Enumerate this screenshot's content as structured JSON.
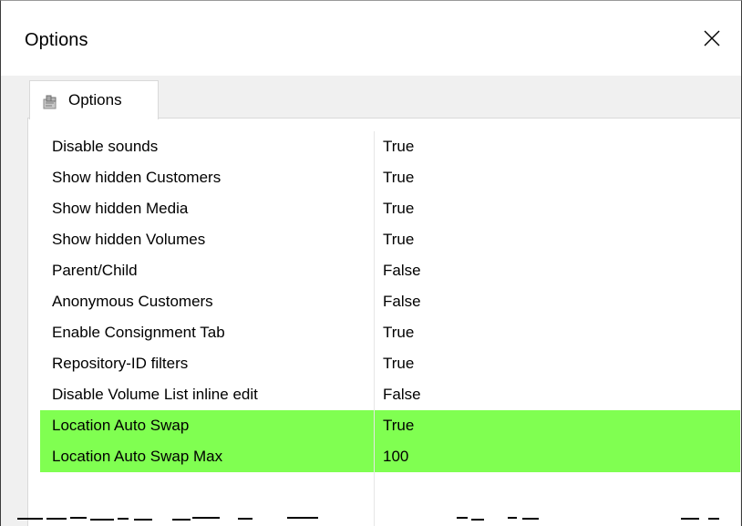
{
  "window": {
    "title": "Options",
    "close_icon": "close-icon"
  },
  "tab": {
    "label": "Options",
    "icon": "options-tab-icon"
  },
  "grid": {
    "rows": [
      {
        "name": "Disable sounds",
        "value": "True",
        "highlighted": false
      },
      {
        "name": "Show hidden Customers",
        "value": "True",
        "highlighted": false
      },
      {
        "name": "Show hidden Media",
        "value": "True",
        "highlighted": false
      },
      {
        "name": "Show hidden Volumes",
        "value": "True",
        "highlighted": false
      },
      {
        "name": "Parent/Child",
        "value": "False",
        "highlighted": false
      },
      {
        "name": "Anonymous Customers",
        "value": "False",
        "highlighted": false
      },
      {
        "name": "Enable Consignment Tab",
        "value": "True",
        "highlighted": false
      },
      {
        "name": "Repository-ID filters",
        "value": "True",
        "highlighted": false
      },
      {
        "name": "Disable Volume List inline edit",
        "value": "False",
        "highlighted": false
      },
      {
        "name": "Location Auto Swap",
        "value": "True",
        "highlighted": true
      },
      {
        "name": "Location Auto Swap Max",
        "value": "100",
        "highlighted": true
      }
    ],
    "highlight_color": "#80ff51"
  }
}
